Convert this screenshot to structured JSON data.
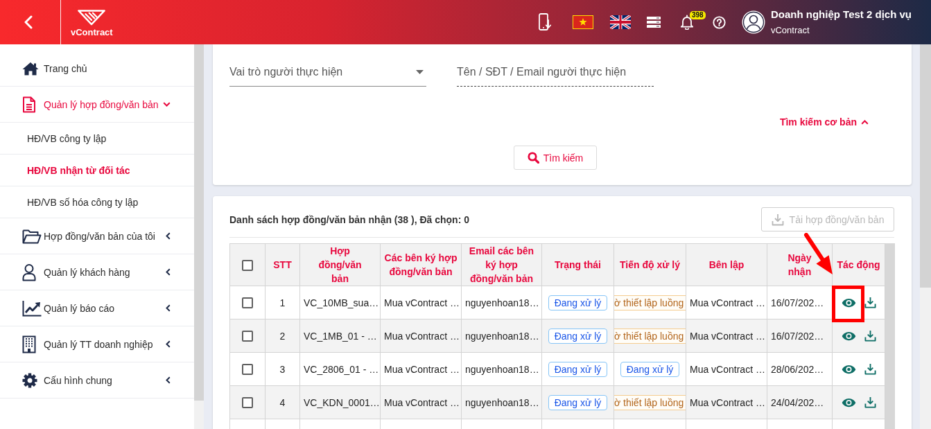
{
  "header": {
    "logo_text": "vContract",
    "notification_count": "398",
    "user": {
      "name": "Doanh nghiệp Test 2 dịch vụ",
      "subtitle": "vContract"
    }
  },
  "sidebar": {
    "items": [
      {
        "label": "Trang chủ",
        "kind": "link",
        "selected": false
      },
      {
        "label": "Quản lý hợp đồng/văn bản",
        "kind": "group",
        "selected": false,
        "expanded": true,
        "children": [
          {
            "label": "HĐ/VB công ty lập",
            "selected": false
          },
          {
            "label": "HĐ/VB nhận từ đối tác",
            "selected": true
          },
          {
            "label": "HĐ/VB số hóa công ty lập",
            "selected": false
          }
        ]
      },
      {
        "label": "Hợp đồng/văn bản của tôi",
        "kind": "group",
        "selected": false,
        "expanded": false
      },
      {
        "label": "Quản lý khách hàng",
        "kind": "group",
        "selected": false,
        "expanded": false
      },
      {
        "label": "Quản lý báo cáo",
        "kind": "group",
        "selected": false,
        "expanded": false
      },
      {
        "label": "Quản lý TT doanh nghiệp",
        "kind": "group",
        "selected": false,
        "expanded": false
      },
      {
        "label": "Cấu hình chung",
        "kind": "group",
        "selected": false,
        "expanded": false
      }
    ]
  },
  "search": {
    "fields": [
      {
        "kind": "select",
        "placeholder": "Vai trò người thực hiện"
      },
      {
        "kind": "text",
        "placeholder": "Tên / SĐT / Email người thực hiện"
      }
    ],
    "mode_toggle": {
      "label": "Tìm kiếm cơ bản",
      "expanded": true
    },
    "submit_label": "Tìm kiếm"
  },
  "list": {
    "title": "Danh sách hợp đồng/văn bản nhận (38 ), Đã chọn: 0",
    "download_button": {
      "label": "Tải hợp đồng/văn bản",
      "disabled": true
    },
    "table": {
      "select_all_checked": false,
      "columns": [
        "STT",
        "Hợp đồng/văn bản",
        "Các bên ký hợp đồng/văn bản",
        "Email các bên ký hợp đồng/văn bản",
        "Trạng thái",
        "Tiến độ xử lý",
        "Bên lập",
        "Ngày nhận",
        "Tác động"
      ],
      "rows": [
        {
          "checked": false,
          "stt": "1",
          "document": "VC_10MB_sua…",
          "signers": "Mua vContract …",
          "email": "nguyenhoan18…",
          "status": {
            "label": "Đang xử lý",
            "kind": "processing"
          },
          "progress": {
            "label": "ờ thiết lập luồng",
            "kind": "waiting"
          },
          "creator": "Mua vContract …",
          "received": "16/07/202…",
          "highlighted": true
        },
        {
          "checked": false,
          "stt": "2",
          "document": "VC_1MB_01 - …",
          "signers": "Mua vContract …",
          "email": "nguyenhoan18…",
          "status": {
            "label": "Đang xử lý",
            "kind": "processing"
          },
          "progress": {
            "label": "ờ thiết lập luồng",
            "kind": "waiting"
          },
          "creator": "Mua vContract …",
          "received": "16/07/202…",
          "highlighted": false
        },
        {
          "checked": false,
          "stt": "3",
          "document": "VC_2806_01 - …",
          "signers": "Mua vContract …",
          "email": "nguyenhoan18…",
          "status": {
            "label": "Đang xử lý",
            "kind": "processing"
          },
          "progress": {
            "label": "Đang xử lý",
            "kind": "processing"
          },
          "creator": "Mua vContract …",
          "received": "28/06/202…",
          "highlighted": false
        },
        {
          "checked": false,
          "stt": "4",
          "document": "VC_KDN_0001…",
          "signers": "Mua vContract …",
          "email": "nguyenhoan18…",
          "status": {
            "label": "Đang xử lý",
            "kind": "processing"
          },
          "progress": {
            "label": "ờ thiết lập luồng",
            "kind": "waiting"
          },
          "creator": "Mua vContract …",
          "received": "24/04/202…",
          "highlighted": false
        }
      ]
    }
  }
}
